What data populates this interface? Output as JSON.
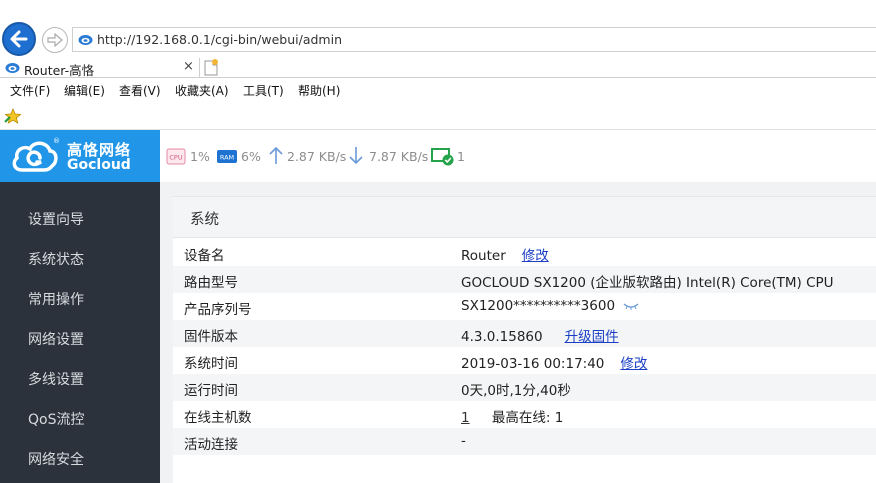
{
  "browser": {
    "url": "http://192.168.0.1/cgi-bin/webui/admin",
    "tab_title": "Router-高恪",
    "tab_close": "×",
    "menu": [
      "文件(F)",
      "编辑(E)",
      "查看(V)",
      "收藏夹(A)",
      "工具(T)",
      "帮助(H)"
    ]
  },
  "brand": {
    "name_cn": "高恪网络",
    "name_en": "Gocloud",
    "registered": "®",
    "color": "#2196e8"
  },
  "status_bar": {
    "cpu_badge": "CPU",
    "cpu": "1%",
    "ram_badge": "RAM",
    "ram": "6%",
    "upload": "2.87 KB/s",
    "download": "7.87 KB/s",
    "online": "1"
  },
  "sidebar": {
    "items": [
      {
        "label": "设置向导"
      },
      {
        "label": "系统状态"
      },
      {
        "label": "常用操作"
      },
      {
        "label": "网络设置"
      },
      {
        "label": "多线设置"
      },
      {
        "label": "QoS流控"
      },
      {
        "label": "网络安全"
      }
    ]
  },
  "panel": {
    "title": "系统",
    "rows": {
      "device_name": {
        "label": "设备名",
        "value": "Router",
        "action": "修改"
      },
      "model": {
        "label": "路由型号",
        "value": "GOCLOUD SX1200 (企业版软路由) Intel(R) Core(TM) CPU"
      },
      "serial": {
        "label": "产品序列号",
        "value": "SX1200**********3600"
      },
      "firmware": {
        "label": "固件版本",
        "value": "4.3.0.15860",
        "action": "升级固件"
      },
      "system_time": {
        "label": "系统时间",
        "value": "2019-03-16 00:17:40",
        "action": "修改"
      },
      "uptime": {
        "label": "运行时间",
        "value": "0天,0时,1分,40秒"
      },
      "online_hosts": {
        "label": "在线主机数",
        "value": "1",
        "peak_label": "最高在线:",
        "peak_value": "1"
      },
      "connections": {
        "label": "活动连接",
        "value": "-"
      }
    }
  }
}
